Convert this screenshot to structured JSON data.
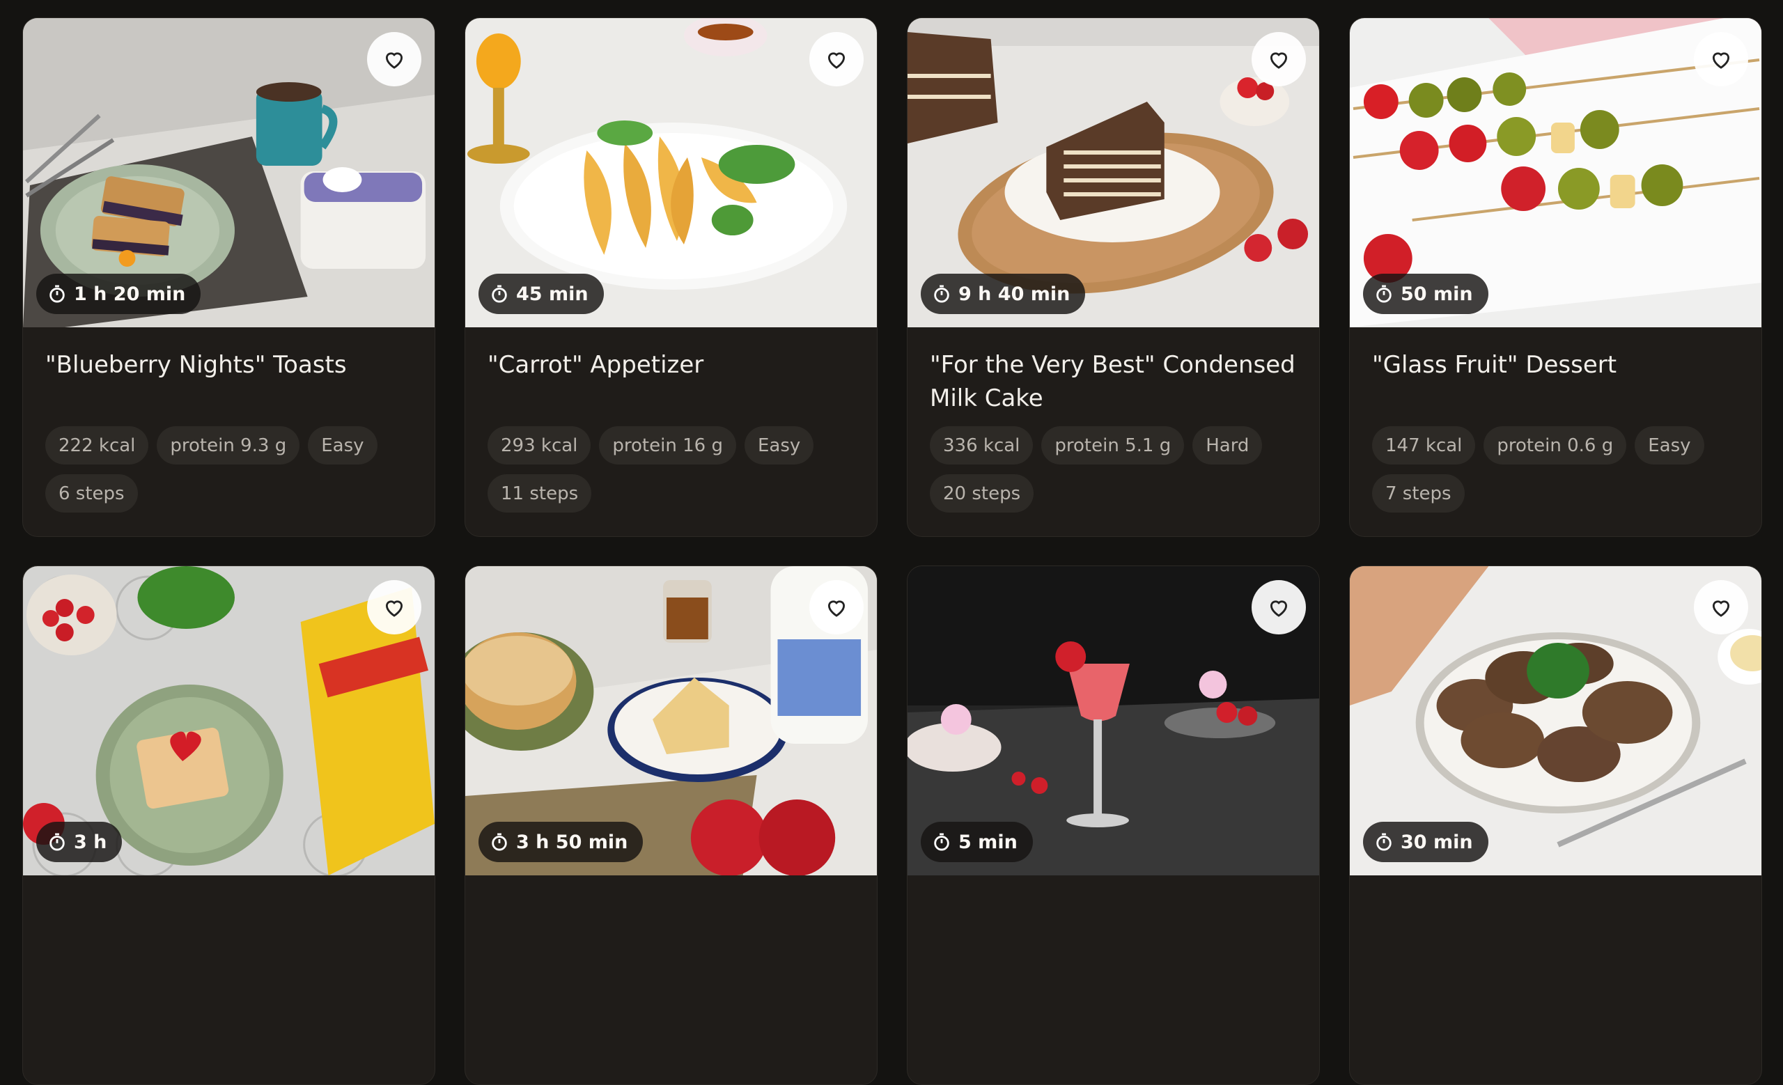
{
  "recipes": [
    {
      "title": "\"Blueberry Nights\" Toasts",
      "time": "1 h 20 min",
      "tags": [
        "222 kcal",
        "protein 9.3 g",
        "Easy",
        "6 steps"
      ],
      "bg": "#dcdad6"
    },
    {
      "title": "\"Carrot\" Appetizer",
      "time": "45 min",
      "tags": [
        "293 kcal",
        "protein 16 g",
        "Easy",
        "11 steps"
      ],
      "bg": "#ecebe8"
    },
    {
      "title": "\"For the Very Best\" Condensed Milk Cake",
      "time": "9 h 40 min",
      "tags": [
        "336 kcal",
        "protein 5.1 g",
        "Hard",
        "20 steps"
      ],
      "bg": "#e7e5e2"
    },
    {
      "title": "\"Glass Fruit\" Dessert",
      "time": "50 min",
      "tags": [
        "147 kcal",
        "protein 0.6 g",
        "Easy",
        "7 steps"
      ],
      "bg": "#efefee"
    },
    {
      "title": "",
      "time": "3 h",
      "tags": [],
      "bg": "#d4d4d2"
    },
    {
      "title": "",
      "time": "3 h 50 min",
      "tags": [],
      "bg": "#e8e6e2"
    },
    {
      "title": "",
      "time": "5 min",
      "tags": [],
      "bg": "#242424"
    },
    {
      "title": "",
      "time": "30 min",
      "tags": [],
      "bg": "#eeedeb"
    }
  ],
  "icons": {
    "favorite": "heart-outline-icon",
    "time": "stopwatch-icon"
  }
}
